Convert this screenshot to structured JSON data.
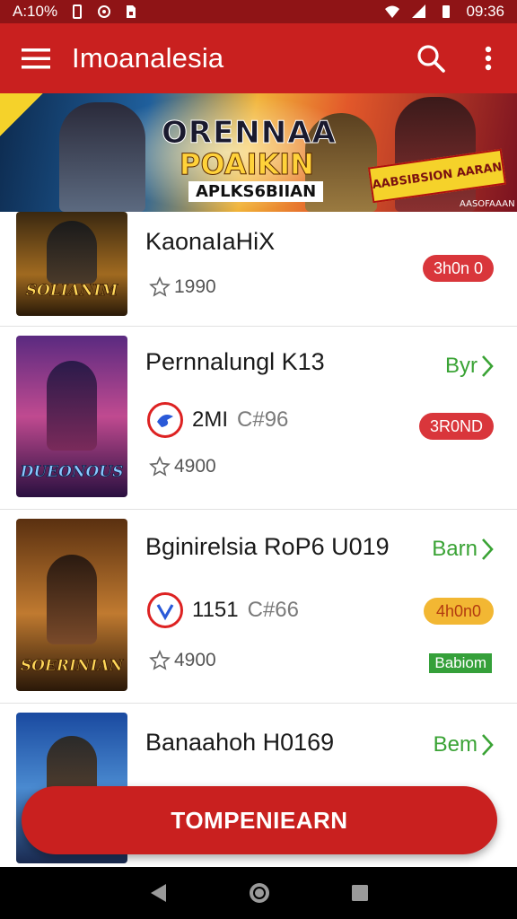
{
  "status_bar": {
    "left_text": "A:10%",
    "time": "09:36",
    "icons": [
      "battery-small-icon",
      "target-icon",
      "sim-card-icon",
      "wifi-icon",
      "signal-icon",
      "battery-icon"
    ]
  },
  "app_bar": {
    "title": "Imoanalesia",
    "menu_icon": "hamburger-menu-icon",
    "search_icon": "search-icon",
    "overflow_icon": "more-vert-icon"
  },
  "banner": {
    "title_line1": "ORENNAA",
    "title_line2": "POAIKIN",
    "title_line3": "APLKS6BIIAN",
    "promo_text": "AABSIBSION AARAN",
    "promo_sub": "AASOFAAAN"
  },
  "items": [
    {
      "title": "KaonaIaHiX",
      "rating": "1990",
      "thumb_label": "SOLIANIM",
      "pill": "3h0n 0",
      "pill_color": "#d9363b"
    },
    {
      "title": "Pernnalungl K13",
      "rating": "4900",
      "thumb_label": "DUEONOUS",
      "meta_main": "2MI",
      "meta_sub": "C#96",
      "pill": "3R0ND",
      "pill_color": "#d9363b",
      "link": "Byr"
    },
    {
      "title": "Bginirelsia RoP6 U019",
      "rating": "4900",
      "thumb_label": "SOERINIAN",
      "meta_main": "1151",
      "meta_sub": "C#66",
      "pill": "4h0n0",
      "pill_color": "#f2b733",
      "pill_text_color": "#b33b10",
      "link": "Barn",
      "tag": "Babiom"
    },
    {
      "title": "Banaahoh H0169",
      "link": "Bem"
    }
  ],
  "fab_label": "TOMPENIEARN",
  "nav_bar": {
    "back_icon": "back-triangle-icon",
    "home_icon": "home-circle-icon",
    "recents_icon": "recents-square-icon"
  },
  "colors": {
    "primary": "#c9201f",
    "status_bar": "#8f1416",
    "accent_green": "#3aa335"
  }
}
